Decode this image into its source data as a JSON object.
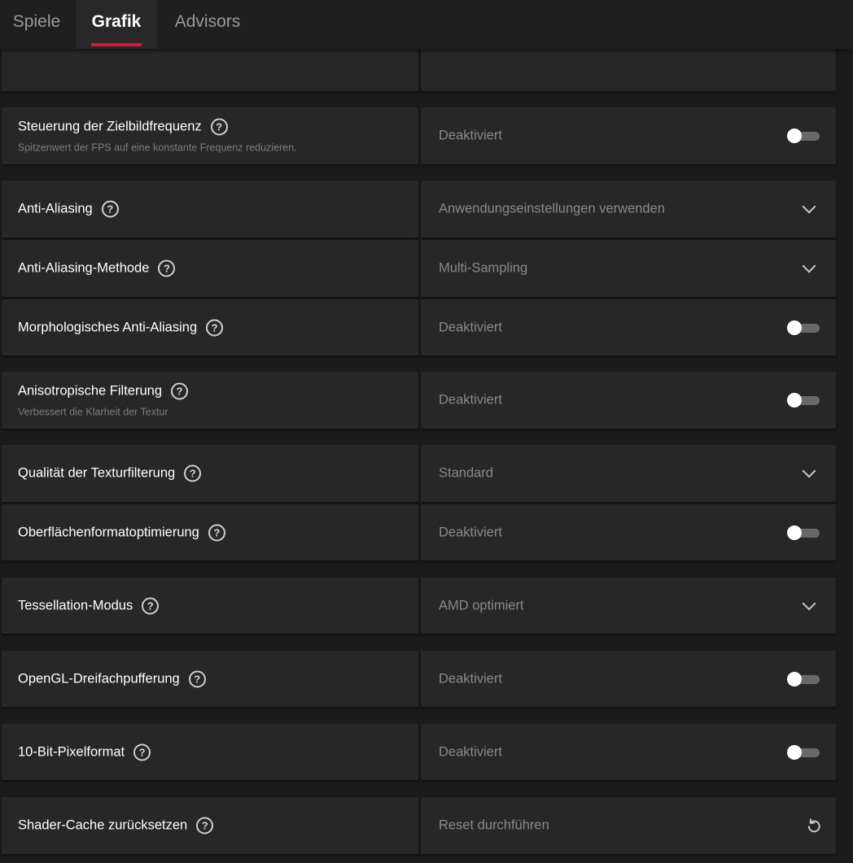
{
  "tabs": [
    {
      "label": "Spiele",
      "active": false
    },
    {
      "label": "Grafik",
      "active": true
    },
    {
      "label": "Advisors",
      "active": false
    }
  ],
  "colors": {
    "accent": "#d6173a",
    "panel": "#272727",
    "background": "#1b1b1b",
    "value_text": "#8a8a8a",
    "sub_text": "#7c7c7c"
  },
  "settings": [
    {
      "label": "Steuerung der Zielbildfrequenz",
      "description": "Spitzenwert der FPS auf eine konstante Frequenz reduzieren.",
      "value": "Deaktiviert",
      "control": "toggle",
      "state": "off"
    },
    {
      "label": "Anti-Aliasing",
      "value": "Anwendungseinstellungen verwenden",
      "control": "dropdown"
    },
    {
      "label": "Anti-Aliasing-Methode",
      "value": "Multi-Sampling",
      "control": "dropdown"
    },
    {
      "label": "Morphologisches Anti-Aliasing",
      "value": "Deaktiviert",
      "control": "toggle",
      "state": "off"
    },
    {
      "label": "Anisotropische Filterung",
      "description": "Verbessert die Klarheit der Textur",
      "value": "Deaktiviert",
      "control": "toggle",
      "state": "off"
    },
    {
      "label": "Qualität der Texturfilterung",
      "value": "Standard",
      "control": "dropdown"
    },
    {
      "label": "Oberflächenformatoptimierung",
      "value": "Deaktiviert",
      "control": "toggle",
      "state": "off"
    },
    {
      "label": "Tessellation-Modus",
      "value": "AMD optimiert",
      "control": "dropdown"
    },
    {
      "label": "OpenGL-Dreifachpufferung",
      "value": "Deaktiviert",
      "control": "toggle",
      "state": "off"
    },
    {
      "label": "10-Bit-Pixelformat",
      "value": "Deaktiviert",
      "control": "toggle",
      "state": "off"
    },
    {
      "label": "Shader-Cache zurücksetzen",
      "value": "Reset durchführen",
      "control": "reset"
    }
  ],
  "icons": {
    "help": "question-circle-icon",
    "help_glyph": "?",
    "dropdown": "chevron-down-icon",
    "toggle": "toggle-switch",
    "reset": "reset-icon"
  }
}
